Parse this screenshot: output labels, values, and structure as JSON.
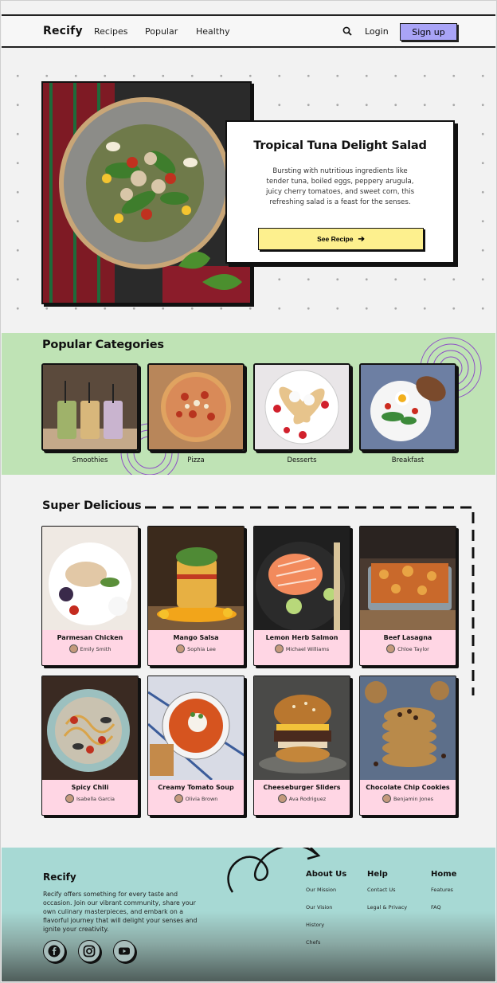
{
  "nav": {
    "logo": "Recify",
    "links": [
      "Recipes",
      "Popular",
      "Healthy"
    ],
    "login": "Login",
    "signup": "Sign up"
  },
  "hero": {
    "title": "Tropical Tuna Delight Salad",
    "description": "Bursting with nutritious ingredients like tender tuna, boiled eggs, peppery arugula, juicy cherry tomatoes, and sweet corn, this refreshing salad is a feast for the senses.",
    "button": "See Recipe"
  },
  "categories": {
    "title": "Popular Categories",
    "items": [
      "Smoothies",
      "Pizza",
      "Desserts",
      "Breakfast"
    ]
  },
  "recipes": {
    "title": "Super Delicious",
    "items": [
      {
        "name": "Parmesan Chicken",
        "author": "Emily Smith"
      },
      {
        "name": "Mango Salsa",
        "author": "Sophia Lee"
      },
      {
        "name": "Lemon Herb Salmon",
        "author": "Michael Williams"
      },
      {
        "name": "Beef Lasagna",
        "author": "Chloe Taylor"
      },
      {
        "name": "Spicy Chili",
        "author": "Isabella Garcia"
      },
      {
        "name": "Creamy Tomato Soup",
        "author": "Olivia Brown"
      },
      {
        "name": "Cheeseburger Sliders",
        "author": "Ava Rodriguez"
      },
      {
        "name": "Chocolate Chip Cookies",
        "author": "Benjamin Jones"
      }
    ]
  },
  "footer": {
    "logo": "Recify",
    "description": "Recify offers something for every taste and occasion. Join our vibrant community, share your own culinary masterpieces, and embark on a flavorful journey that will delight your senses and ignite your creativity.",
    "columns": [
      {
        "title": "About Us",
        "links": [
          "Our Mission",
          "Our Vision",
          "History",
          "Chefs"
        ]
      },
      {
        "title": "Help",
        "links": [
          "Contact Us",
          "Legal & Privacy"
        ]
      },
      {
        "title": "Home",
        "links": [
          "Features",
          "FAQ"
        ]
      }
    ]
  },
  "colors": {
    "signup": "#a9a4f7",
    "hero_button": "#fdf08e",
    "categories_bg": "#bfe3b5",
    "recipe_card": "#ffd6e4",
    "footer_bg": "#a7d9d4"
  }
}
